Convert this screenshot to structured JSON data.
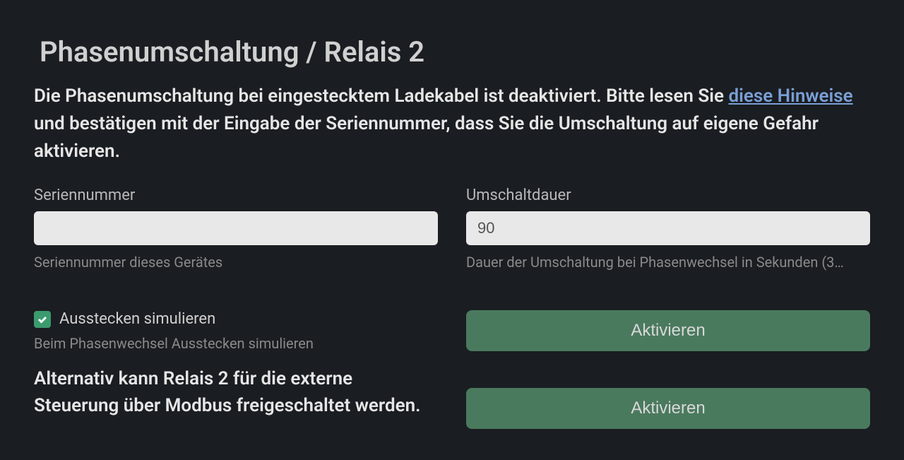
{
  "title": "Phasenumschaltung / Relais 2",
  "description": {
    "part1": "Die Phasenumschaltung bei eingestecktem Ladekabel ist deaktiviert. Bitte lesen Sie ",
    "link_text": "diese Hinweise",
    "part2": " und bestätigen mit der Eingabe der Seriennummer, dass Sie die Umschaltung auf eigene Gefahr aktivieren."
  },
  "serial": {
    "label": "Seriennummer",
    "value": "",
    "help": "Seriennummer dieses Gerätes"
  },
  "duration": {
    "label": "Umschaltdauer",
    "value": "90",
    "help": "Dauer der Umschaltung bei Phasenwechsel in Sekunden (3…"
  },
  "simulate": {
    "label": "Ausstecken simulieren",
    "help": "Beim Phasenwechsel Ausstecken simulieren",
    "checked": true
  },
  "alt_description": "Alternativ kann Relais 2 für die externe Steuerung über Modbus freigeschaltet werden.",
  "buttons": {
    "activate1": "Aktivieren",
    "activate2": "Aktivieren"
  }
}
